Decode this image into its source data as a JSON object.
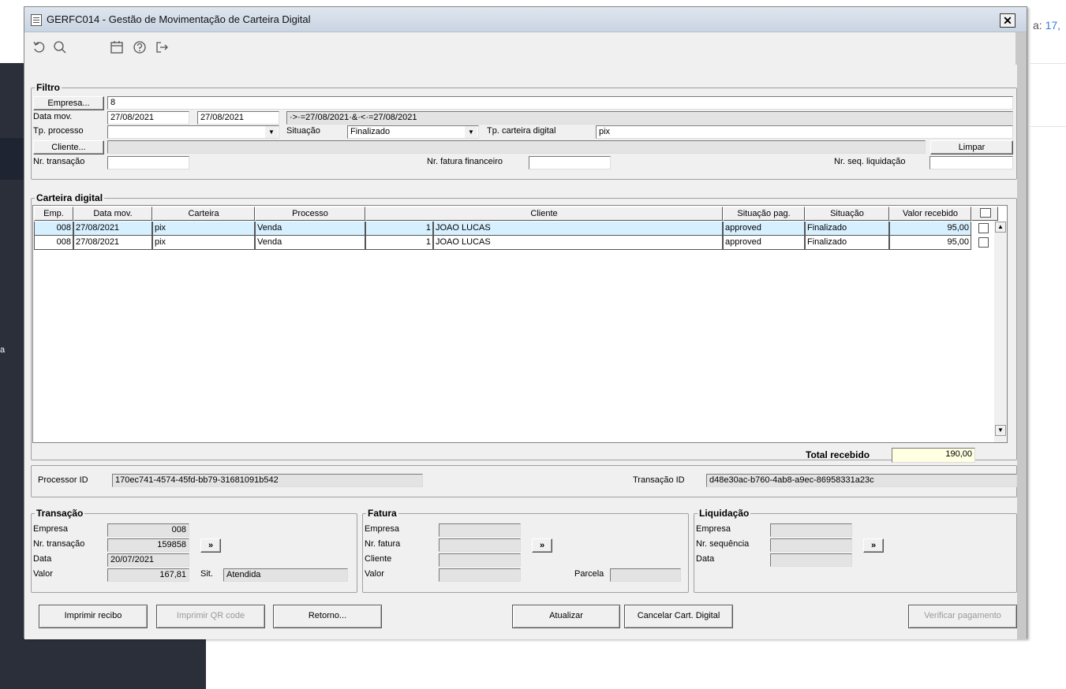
{
  "background": {
    "right_text_prefix": "a:",
    "right_text_value": "17,",
    "sidebar_letter": "a"
  },
  "window": {
    "title": "GERFC014 - Gestão de Movimentação de Carteira Digital",
    "close_label": "✕"
  },
  "toolbar": {
    "icons": [
      "undo-icon",
      "search-icon",
      "calendar-icon",
      "help-icon",
      "exit-icon"
    ]
  },
  "filtro": {
    "legend": "Filtro",
    "empresa_button": "Empresa...",
    "empresa_value": "8",
    "data_mov_label": "Data mov.",
    "data_mov_from": "27/08/2021",
    "data_mov_to": "27/08/2021",
    "data_mov_expr": "·>·=27/08/2021·&·<·=27/08/2021",
    "tp_processo_label": "Tp. processo",
    "tp_processo_value": "",
    "situacao_label": "Situação",
    "situacao_value": "Finalizado",
    "tp_carteira_label": "Tp. carteira digital",
    "tp_carteira_value": "pix",
    "cliente_button": "Cliente...",
    "cliente_value": "",
    "limpar_button": "Limpar",
    "nr_transacao_label": "Nr. transação",
    "nr_transacao_value": "",
    "nr_fatura_label": "Nr. fatura financeiro",
    "nr_fatura_value": "",
    "nr_seq_label": "Nr. seq. liquidação",
    "nr_seq_value": ""
  },
  "carteira": {
    "legend": "Carteira digital",
    "columns": [
      "Emp.",
      "Data mov.",
      "Carteira",
      "Processo",
      "Cliente",
      "Situação pag.",
      "Situação",
      "Valor recebido"
    ],
    "rows": [
      {
        "emp": "008",
        "data": "27/08/2021",
        "carteira": "pix",
        "processo": "Venda",
        "cliente_cod": "1",
        "cliente_nome": "JOAO LUCAS",
        "sit_pag": "approved",
        "situacao": "Finalizado",
        "valor": "95,00"
      },
      {
        "emp": "008",
        "data": "27/08/2021",
        "carteira": "pix",
        "processo": "Venda",
        "cliente_cod": "1",
        "cliente_nome": "JOAO LUCAS",
        "sit_pag": "approved",
        "situacao": "Finalizado",
        "valor": "95,00"
      }
    ],
    "total_label": "Total recebido",
    "total_value": "190,00"
  },
  "ids": {
    "processor_label": "Processor ID",
    "processor_value": "170ec741-4574-45fd-bb79-31681091b542",
    "transacao_label": "Transação ID",
    "transacao_value": "d48e30ac-b760-4ab8-a9ec-86958331a23c"
  },
  "transacao": {
    "legend": "Transação",
    "empresa_label": "Empresa",
    "empresa_value": "008",
    "nr_label": "Nr. transação",
    "nr_value": "159858",
    "data_label": "Data",
    "data_value": "20/07/2021",
    "valor_label": "Valor",
    "valor_value": "167,81",
    "sit_label": "Sit.",
    "sit_value": "Atendida",
    "go_button": "»"
  },
  "fatura": {
    "legend": "Fatura",
    "empresa_label": "Empresa",
    "nr_label": "Nr. fatura",
    "cliente_label": "Cliente",
    "valor_label": "Valor",
    "parcela_label": "Parcela",
    "go_button": "»"
  },
  "liquidacao": {
    "legend": "Liquidação",
    "empresa_label": "Empresa",
    "nr_label": "Nr. sequência",
    "data_label": "Data",
    "go_button": "»"
  },
  "actions": {
    "imprimir_recibo": "Imprimir recibo",
    "imprimir_qr": "Imprimir QR code",
    "retorno": "Retorno...",
    "atualizar": "Atualizar",
    "cancelar": "Cancelar Cart. Digital",
    "verificar": "Verificar pagamento"
  }
}
